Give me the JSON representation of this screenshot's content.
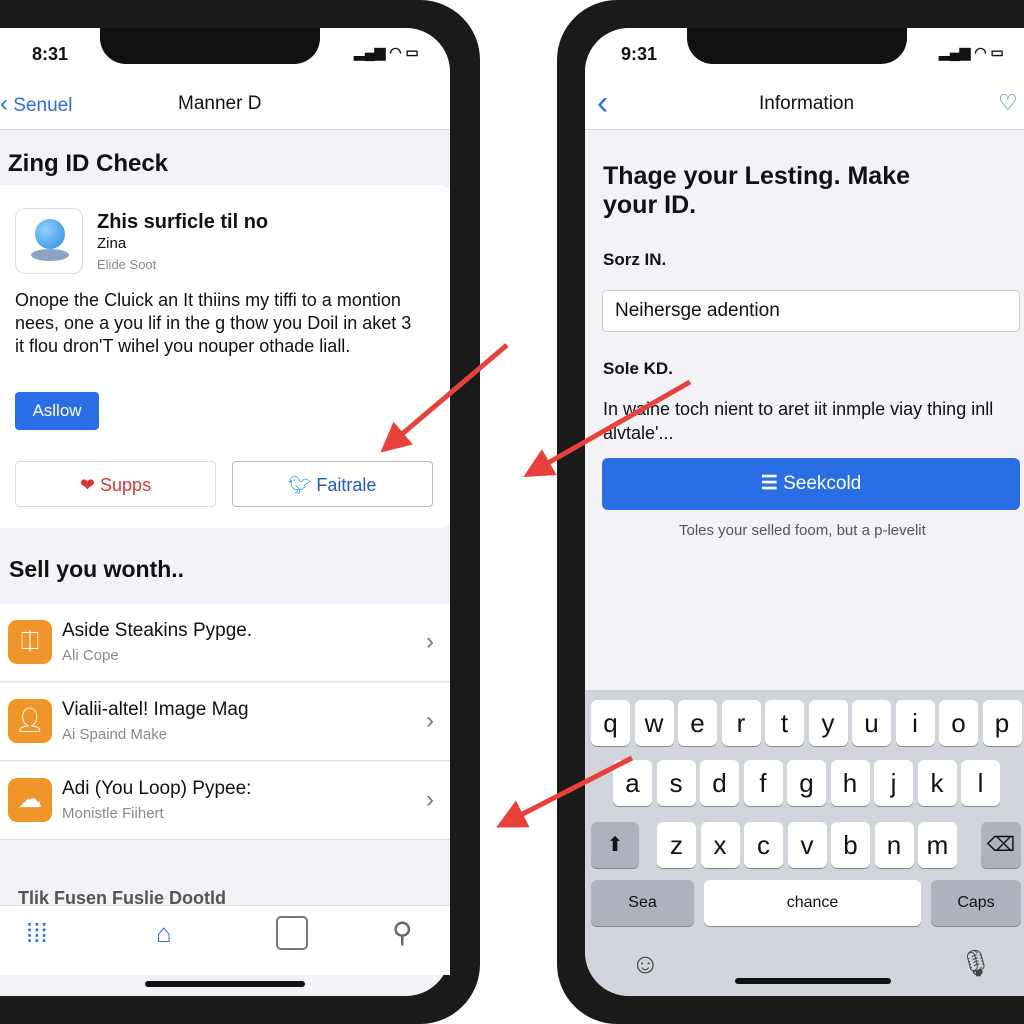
{
  "left_phone": {
    "status_time": "8:31",
    "nav": {
      "back_label": "Senuel",
      "title": "Manner D"
    },
    "page_title": "Zing ID Check",
    "card": {
      "title": "Zhis surficle til no",
      "subtitle": "Zina",
      "meta": "Elide Soot",
      "body": "Onope the Cluick an It thiins my tiffi to a montion nees, one a you lif in the g thow you Doil in aket 3 it flou dron'T wihel you nouper othade liall.",
      "allow_button": "Asllow",
      "supps_button": "Supps",
      "share_button": "Faitrale"
    },
    "section_title": "Sell you wonth..",
    "list": [
      {
        "title": "Aside Steakins Pypge.",
        "subtitle": "Ali Cope",
        "icon": "gift-icon"
      },
      {
        "title": "Vialii-altel! Image Mag",
        "subtitle": "Ai Spaind Make",
        "icon": "person-icon"
      },
      {
        "title": "Adi (You Loop) Pypee:",
        "subtitle": "Monistle Fiihert",
        "icon": "cloud-icon"
      }
    ],
    "faded_text": "Tlik Fusen Fuslie Dootld",
    "tabs": [
      "grid-icon",
      "home-icon",
      "wallet-icon",
      "profile-icon"
    ]
  },
  "right_phone": {
    "status_time": "9:31",
    "nav": {
      "title": "Information"
    },
    "heading": "Thage your Lesting. Make your ID.",
    "field_label": "Sorz IN.",
    "field_value": "Neihersge adention",
    "section_label": "Sole KD.",
    "paragraph": "In waine toch nient to aret iit inmple viay thing inll alvtale'...",
    "primary_button": "Seekcold",
    "caption": "Toles your selled foom, but a p-levelit",
    "keyboard": {
      "row1": [
        "q",
        "w",
        "e",
        "r",
        "t",
        "y",
        "u",
        "i",
        "o",
        "p"
      ],
      "row2": [
        "a",
        "s",
        "d",
        "f",
        "g",
        "h",
        "j",
        "k",
        "l"
      ],
      "row3": [
        "z",
        "x",
        "c",
        "v",
        "b",
        "n",
        "m"
      ],
      "left_key": "Sea",
      "space_key": "chance",
      "right_key": "Caps"
    }
  },
  "colors": {
    "accent": "#2a6ee6",
    "orange": "#f0952a",
    "arrow": "#e8403a",
    "keyboard_bg": "#d1d4da"
  }
}
